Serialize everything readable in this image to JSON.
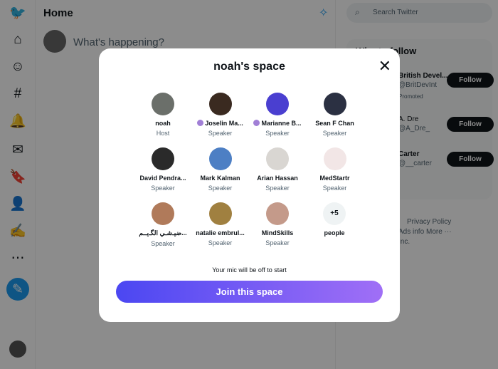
{
  "main": {
    "title": "Home",
    "compose_placeholder": "What's happening?"
  },
  "right": {
    "search_placeholder": "Search Twitter",
    "who_to_follow": "Who to follow",
    "suggestions": [
      {
        "name": "British Devel...",
        "handle": "@BritDevInt",
        "note": "Promoted",
        "follow": "Follow"
      },
      {
        "name": "A. Dre",
        "handle": "@A_Dre_",
        "follow": "Follow"
      },
      {
        "name": "Carter",
        "handle": "@__carter",
        "follow": "Follow"
      }
    ],
    "footer": [
      "Privacy Policy",
      "Ads info",
      "More ···",
      "Inc."
    ]
  },
  "modal": {
    "title": "noah's space",
    "mic_note": "Your mic will be off to start",
    "join_label": "Join this space",
    "participants": [
      {
        "name": "noah",
        "role": "Host",
        "color": "#6b6f6a"
      },
      {
        "name": "Joselin Ma...",
        "role": "Speaker",
        "color": "#3a2a20",
        "dot": true
      },
      {
        "name": "Marianne B...",
        "role": "Speaker",
        "color": "#4a3fd0",
        "dot": true
      },
      {
        "name": "Sean F Chan",
        "role": "Speaker",
        "color": "#2b3042"
      },
      {
        "name": "David Pendra...",
        "role": "Speaker",
        "color": "#2a2a2a"
      },
      {
        "name": "Mark Kalman",
        "role": "Speaker",
        "color": "#4d7fc4"
      },
      {
        "name": "Arian Hassan",
        "role": "Speaker",
        "color": "#d9d6d2"
      },
      {
        "name": "MedStartr",
        "role": "Speaker",
        "color": "#f2e6e6"
      },
      {
        "name": "ضيـ‌شـي الگـ‌يـ‌ـم...",
        "role": "Speaker",
        "color": "#b07a5a"
      },
      {
        "name": "natalie embrul...",
        "role": "Speaker",
        "color": "#a08040"
      },
      {
        "name": "MindSkills",
        "role": "Speaker",
        "color": "#c49a8a"
      }
    ],
    "more": {
      "count": "+5",
      "label": "people"
    }
  }
}
